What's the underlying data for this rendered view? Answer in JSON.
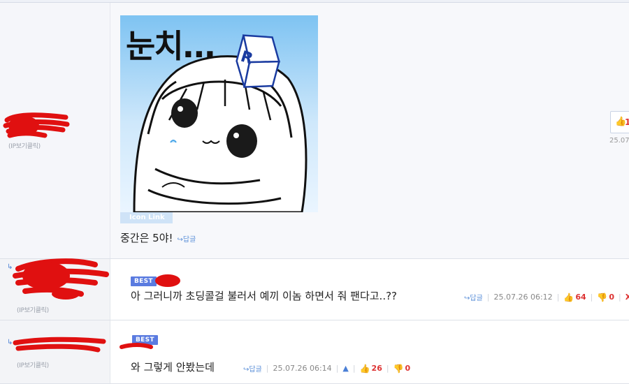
{
  "comments": [
    {
      "ip_label": "(IP보기클릭)",
      "image": {
        "caption": "눈치...",
        "icon_link_label": "Icon Link"
      },
      "text": "중간은 5야!",
      "reply_label": "↪답글",
      "side_vote": {
        "count": "1",
        "date": "25.07."
      }
    },
    {
      "ip_label": "(IP보기클릭)",
      "best_label": "BEST",
      "text": "아 그러니까 초딩콜걸 불러서 예끼 이놈 하면서 줘 팬다고..??",
      "reply_label": "↪답글",
      "date": "25.07.26 06:12",
      "up": "64",
      "down": "0",
      "delete": "X"
    },
    {
      "ip_label": "(IP보기클릭)",
      "best_label": "BEST",
      "text": "와 그렇게 안봤는데",
      "reply_label": "↪답글",
      "date": "25.07.26 06:14",
      "up": "26",
      "down": "0"
    }
  ],
  "icons": {
    "thumb_up": "👍",
    "thumb_down": "👎",
    "bell": "🔔",
    "reply_arrow": "↳"
  },
  "colors": {
    "accent_blue": "#4a7fd6",
    "best_badge": "#5a7be0",
    "vote_red": "#dd3333",
    "redaction_red": "#e01010"
  }
}
